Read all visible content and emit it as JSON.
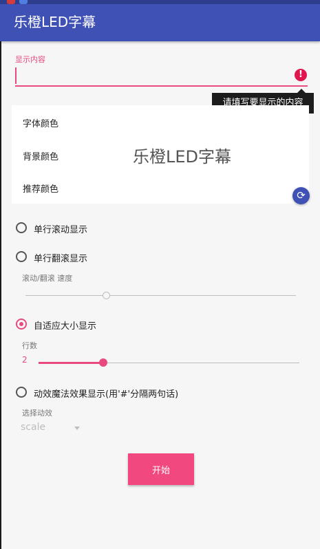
{
  "app": {
    "title": "乐橙LED字幕"
  },
  "content_field": {
    "label": "显示内容",
    "value": "",
    "error_tooltip": "请填写要显示的内容"
  },
  "color_panel": {
    "font_color_label": "字体颜色",
    "background_color_label": "背景颜色",
    "recommended_color_label": "推荐颜色",
    "preview_text": "乐橙LED字幕"
  },
  "modes": {
    "single_scroll": {
      "label": "单行滚动显示",
      "checked": false
    },
    "single_flip": {
      "label": "单行翻滚显示",
      "checked": false
    },
    "speed_label": "滚动/翻滚 速度",
    "adaptive": {
      "label": "自适应大小显示",
      "checked": true
    },
    "rows_label": "行数",
    "rows_value": "2",
    "magic": {
      "label": "动效魔法效果显示(用'#'分隔两句话)",
      "checked": false
    },
    "animation_label": "选择动效",
    "animation_selected": "scale"
  },
  "actions": {
    "start_label": "开始"
  },
  "colors": {
    "primary": "#3f51b5",
    "accent": "#e84a7f",
    "button": "#f0487f"
  }
}
